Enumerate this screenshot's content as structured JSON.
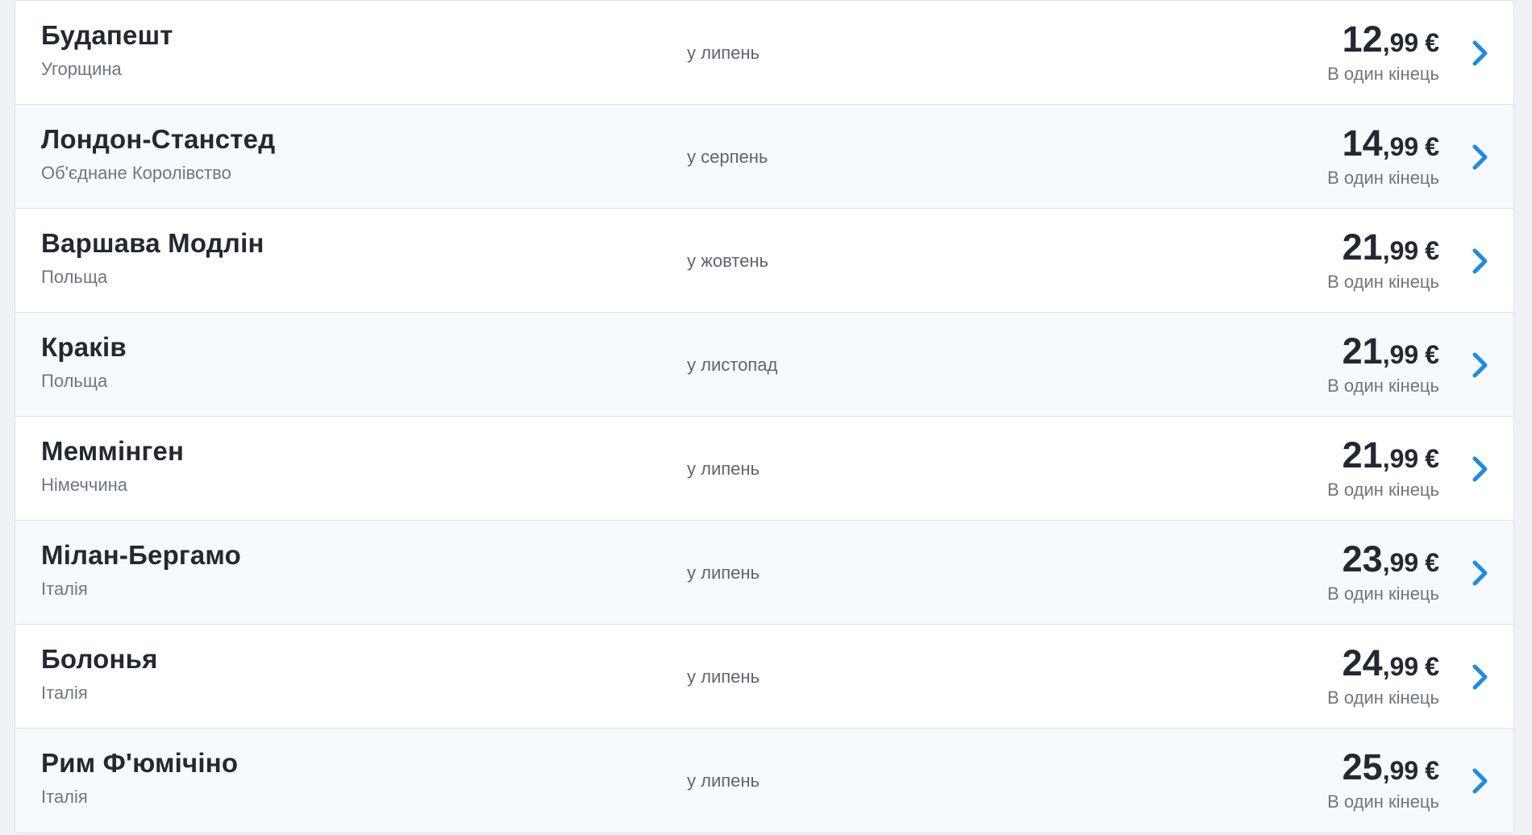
{
  "colors": {
    "accent": "#1b8bea",
    "text": "#222932",
    "muted": "#6e7781"
  },
  "icons": {
    "row_arrow": "chevron-right-icon"
  },
  "flights": [
    {
      "city": "Будапешт",
      "country": "Угорщина",
      "month": "у липень",
      "price_int": "12",
      "price_dec": ",99",
      "currency": "€",
      "note": "В один кінець"
    },
    {
      "city": "Лондон-Станстед",
      "country": "Об'єднане Королівство",
      "month": "у серпень",
      "price_int": "14",
      "price_dec": ",99",
      "currency": "€",
      "note": "В один кінець"
    },
    {
      "city": "Варшава Модлін",
      "country": "Польща",
      "month": "у жовтень",
      "price_int": "21",
      "price_dec": ",99",
      "currency": "€",
      "note": "В один кінець"
    },
    {
      "city": "Краків",
      "country": "Польща",
      "month": "у листопад",
      "price_int": "21",
      "price_dec": ",99",
      "currency": "€",
      "note": "В один кінець"
    },
    {
      "city": "Меммінген",
      "country": "Німеччина",
      "month": "у липень",
      "price_int": "21",
      "price_dec": ",99",
      "currency": "€",
      "note": "В один кінець"
    },
    {
      "city": "Мілан-Бергамо",
      "country": "Італія",
      "month": "у липень",
      "price_int": "23",
      "price_dec": ",99",
      "currency": "€",
      "note": "В один кінець"
    },
    {
      "city": "Болонья",
      "country": "Італія",
      "month": "у липень",
      "price_int": "24",
      "price_dec": ",99",
      "currency": "€",
      "note": "В один кінець"
    },
    {
      "city": "Рим Ф'юмічіно",
      "country": "Італія",
      "month": "у липень",
      "price_int": "25",
      "price_dec": ",99",
      "currency": "€",
      "note": "В один кінець"
    }
  ]
}
